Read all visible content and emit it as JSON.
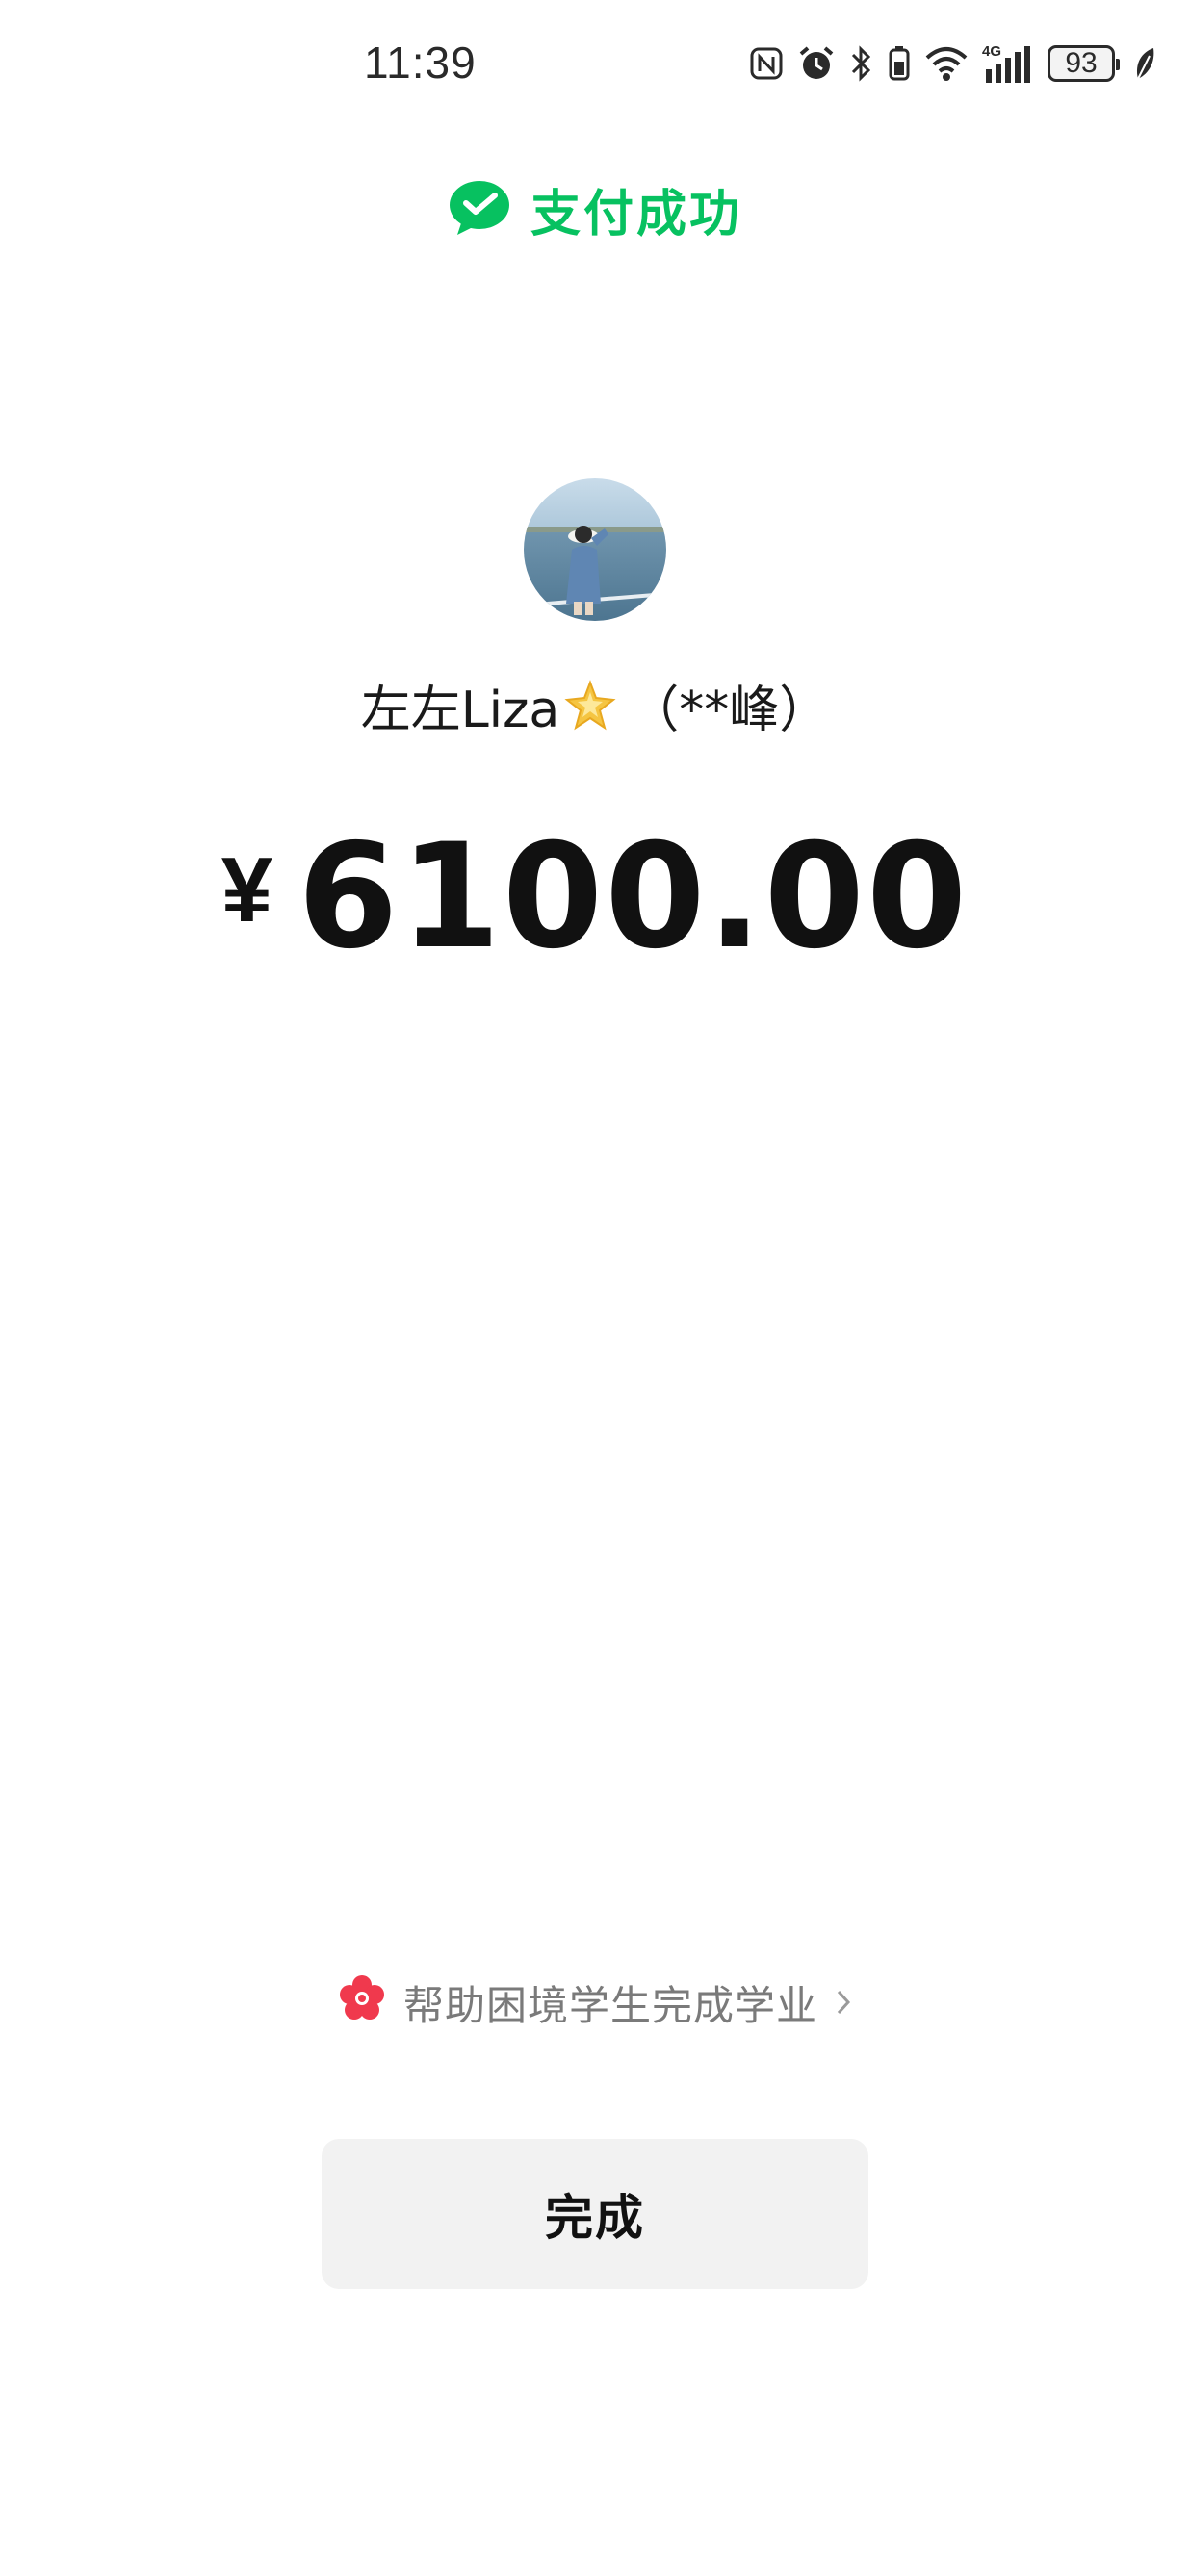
{
  "status_bar": {
    "time": "11:39",
    "network": "4G",
    "battery": "93",
    "icons": [
      "nfc-icon",
      "alarm-icon",
      "bluetooth-icon",
      "wifi-icon",
      "cellular-signal-icon",
      "battery-icon",
      "leaf-icon"
    ]
  },
  "header": {
    "title": "支付成功",
    "icon": "wechat-pay-icon",
    "color": "#07c160"
  },
  "recipient": {
    "name": "左左Liza",
    "emoji": "star-icon",
    "masked_name": "（**峰）"
  },
  "payment": {
    "currency": "¥",
    "amount": "6100.00"
  },
  "charity": {
    "icon": "red-flower-icon",
    "text": "帮助困境学生完成学业",
    "accent": "#f0394d"
  },
  "actions": {
    "done_label": "完成"
  }
}
